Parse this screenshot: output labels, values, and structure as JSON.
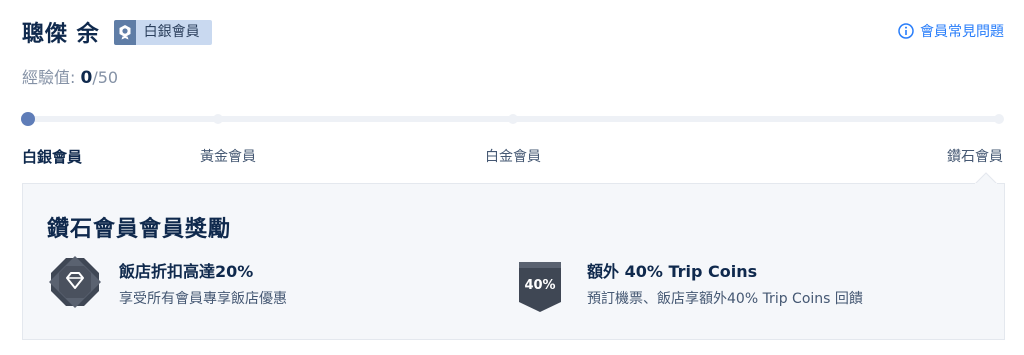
{
  "user": {
    "name": "聰傑 余",
    "tier_badge": "白銀會員"
  },
  "faq": {
    "label": "會員常見問題"
  },
  "experience": {
    "label": "經驗值: ",
    "current": "0",
    "target": "/50"
  },
  "progress": {
    "tiers": [
      {
        "label": "白銀會員"
      },
      {
        "label": "黃金會員"
      },
      {
        "label": "白金會員"
      },
      {
        "label": "鑽石會員"
      }
    ],
    "current_tier_index": 0
  },
  "rewards": {
    "title": "鑽石會員會員獎勵",
    "benefits": [
      {
        "title": "飯店折扣高達20%",
        "description": "享受所有會員專享飯店優惠",
        "icon": "diamond-hotel-icon"
      },
      {
        "title": "額外 40% Trip Coins",
        "description": "預訂機票、飯店享額外40% Trip Coins 回饋",
        "icon": "40-percent-badge-icon",
        "badge_text": "40%"
      }
    ]
  },
  "colors": {
    "accent": "#287dfa",
    "text_primary": "#0f294d",
    "progress_active": "#5f7db8",
    "badge_bg": "#c9d9f0"
  }
}
